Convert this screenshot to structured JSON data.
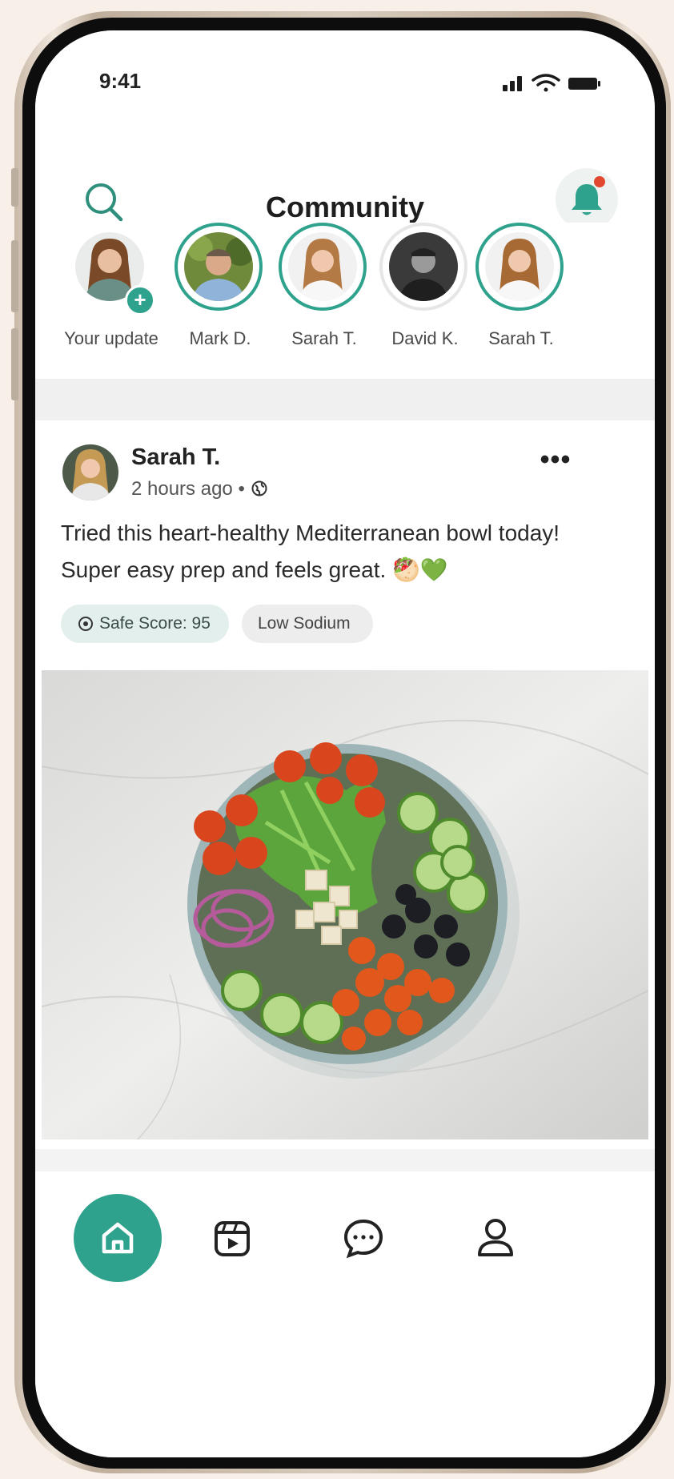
{
  "status_bar": {
    "time": "9:41"
  },
  "header": {
    "title": "Community"
  },
  "colors": {
    "accent": "#2ea28c",
    "notification_dot": "#e2472f"
  },
  "stories": [
    {
      "name": "Your update",
      "is_own": true
    },
    {
      "name": "Mark D."
    },
    {
      "name": "Sarah T."
    },
    {
      "name": "David K."
    },
    {
      "name": "Sarah T."
    }
  ],
  "post": {
    "author": "Sarah T.",
    "time": "2 hours ago",
    "separator": "•",
    "text": "Tried this heart-healthy Mediterranean bowl today! Super easy prep and feels great. 🥙💚",
    "tags": {
      "score": "Safe Score: 95",
      "sodium": "Low Sodium"
    },
    "more": "•••"
  },
  "nav": {
    "items": [
      "home-icon",
      "reels-icon",
      "chat-icon",
      "profile-icon"
    ],
    "active": "home-icon"
  }
}
